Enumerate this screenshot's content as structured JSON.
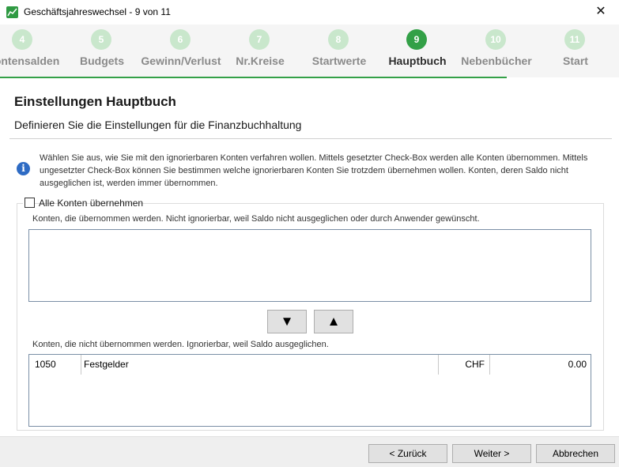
{
  "window": {
    "title": "Geschäftsjahreswechsel - 9 von 11",
    "close": "✕"
  },
  "steps": [
    {
      "number": "4",
      "label": "Kontensalden",
      "active": false
    },
    {
      "number": "5",
      "label": "Budgets",
      "active": false
    },
    {
      "number": "6",
      "label": "Gewinn/Verlust",
      "active": false
    },
    {
      "number": "7",
      "label": "Nr.Kreise",
      "active": false
    },
    {
      "number": "8",
      "label": "Startwerte",
      "active": false
    },
    {
      "number": "9",
      "label": "Hauptbuch",
      "active": true
    },
    {
      "number": "10",
      "label": "Nebenbücher",
      "active": false
    },
    {
      "number": "11",
      "label": "Start",
      "active": false
    }
  ],
  "header": {
    "title": "Einstellungen Hauptbuch",
    "subtitle": "Definieren Sie die Einstellungen für die Finanzbuchhaltung"
  },
  "info": {
    "icon": "i",
    "text": "Wählen Sie aus, wie Sie mit den ignorierbaren Konten verfahren wollen. Mittels gesetzter Check-Box werden alle Konten übernommen. Mittels ungesetzter Check-Box können Sie bestimmen welche ignorierbaren Konten Sie trotzdem übernehmen wollen. Konten, deren Saldo nicht ausgeglichen ist, werden immer übernommen."
  },
  "checkbox": {
    "label": "Alle Konten übernehmen",
    "checked": false
  },
  "transferred": {
    "label": "Konten, die übernommen werden. Nicht ignorierbar, weil Saldo nicht ausgeglichen oder durch Anwender gewünscht."
  },
  "move_buttons": {
    "down": "▼",
    "up": "▲"
  },
  "not_transferred": {
    "label": "Konten, die nicht übernommen werden. Ignorierbar, weil Saldo ausgeglichen.",
    "rows": [
      {
        "number": "1050",
        "name": "Festgelder",
        "currency": "CHF",
        "value": "0.00"
      }
    ]
  },
  "buttons": {
    "back": "< Zurück",
    "next": "Weiter >",
    "cancel": "Abbrechen"
  },
  "colors": {
    "accent": "#33a047",
    "accent_light": "#c9e7cc",
    "info_blue": "#2e6bc4"
  }
}
